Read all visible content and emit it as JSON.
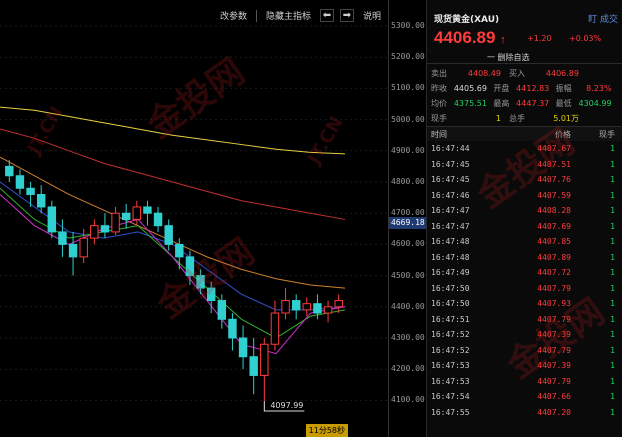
{
  "toolbar": {
    "buttons": [
      "改参数",
      "隐藏主指标",
      "说明"
    ],
    "prev_arrow": "⬅",
    "next_arrow": "➡"
  },
  "y_axis": {
    "ticks": [
      "5300.00",
      "5200.00",
      "5100.00",
      "5000.00",
      "4900.00",
      "4800.00",
      "4700.00",
      "4600.00",
      "4500.00",
      "4400.00",
      "4300.00",
      "4200.00",
      "4100.00"
    ],
    "current_price": "4669.18"
  },
  "chart": {
    "low_label": "4097.99",
    "countdown": "11分58秒"
  },
  "chart_data": {
    "type": "line",
    "ylim": [
      4090,
      5300
    ],
    "candles": [
      [
        4850,
        4820,
        4870,
        4800
      ],
      [
        4820,
        4780,
        4840,
        4760
      ],
      [
        4780,
        4760,
        4800,
        4720
      ],
      [
        4760,
        4720,
        4790,
        4700
      ],
      [
        4720,
        4640,
        4740,
        4620
      ],
      [
        4640,
        4600,
        4680,
        4560
      ],
      [
        4600,
        4560,
        4640,
        4500
      ],
      [
        4560,
        4620,
        4650,
        4540
      ],
      [
        4620,
        4660,
        4680,
        4600
      ],
      [
        4660,
        4640,
        4700,
        4620
      ],
      [
        4640,
        4700,
        4720,
        4630
      ],
      [
        4700,
        4680,
        4730,
        4650
      ],
      [
        4680,
        4720,
        4740,
        4660
      ],
      [
        4720,
        4700,
        4740,
        4660
      ],
      [
        4700,
        4660,
        4720,
        4640
      ],
      [
        4660,
        4600,
        4680,
        4580
      ],
      [
        4600,
        4560,
        4620,
        4520
      ],
      [
        4560,
        4500,
        4580,
        4470
      ],
      [
        4500,
        4460,
        4520,
        4440
      ],
      [
        4460,
        4420,
        4480,
        4380
      ],
      [
        4420,
        4360,
        4440,
        4330
      ],
      [
        4360,
        4300,
        4380,
        4260
      ],
      [
        4300,
        4240,
        4340,
        4200
      ],
      [
        4240,
        4180,
        4300,
        4120
      ],
      [
        4180,
        4280,
        4300,
        4098
      ],
      [
        4280,
        4380,
        4420,
        4260
      ],
      [
        4380,
        4420,
        4460,
        4360
      ],
      [
        4420,
        4390,
        4440,
        4360
      ],
      [
        4390,
        4410,
        4430,
        4370
      ],
      [
        4410,
        4380,
        4440,
        4360
      ],
      [
        4380,
        4400,
        4420,
        4350
      ],
      [
        4400,
        4420,
        4440,
        4380
      ]
    ],
    "series": [
      {
        "values": [
          5040,
          5030,
          5010,
          4990,
          4970,
          4950,
          4935,
          4920,
          4905,
          4895,
          4890
        ]
      },
      {
        "values": [
          4970,
          4940,
          4900,
          4860,
          4830,
          4800,
          4770,
          4740,
          4720,
          4700,
          4680
        ]
      },
      {
        "values": [
          4880,
          4820,
          4760,
          4710,
          4660,
          4610,
          4560,
          4520,
          4490,
          4470,
          4460
        ]
      },
      {
        "values": [
          4800,
          4720,
          4640,
          4620,
          4640,
          4600,
          4520,
          4440,
          4390,
          4390,
          4400
        ]
      },
      {
        "values": [
          4780,
          4680,
          4620,
          4640,
          4660,
          4560,
          4460,
          4360,
          4300,
          4370,
          4390
        ]
      },
      {
        "values": [
          4760,
          4660,
          4600,
          4650,
          4680,
          4560,
          4420,
          4280,
          4250,
          4380,
          4400
        ]
      }
    ],
    "series_colors": [
      "#e8d040",
      "#c03030",
      "#d08030",
      "#3050d0",
      "#30b030",
      "#d030d0"
    ]
  },
  "panel": {
    "title": "现货黄金(XAU)",
    "volume_label": "盯 成交",
    "price": "4406.89",
    "arrow": "↑",
    "change": "+1.20",
    "change_pct": "+0.03%",
    "fav_label": "一 删除自选",
    "quote_rows": [
      [
        {
          "l": "卖出",
          "v": "4408.49",
          "c": "red"
        },
        {
          "l": "买入",
          "v": "4406.89",
          "c": "red"
        }
      ],
      [
        {
          "l": "昨收",
          "v": "4405.69",
          "c": "white"
        },
        {
          "l": "开盘",
          "v": "4412.83",
          "c": "red"
        },
        {
          "l": "振幅",
          "v": "8.23%",
          "c": "red"
        }
      ],
      [
        {
          "l": "均价",
          "v": "4375.51",
          "c": "green"
        },
        {
          "l": "最高",
          "v": "4447.37",
          "c": "red"
        },
        {
          "l": "最低",
          "v": "4304.99",
          "c": "green"
        }
      ],
      [
        {
          "l": "现手",
          "v": "1",
          "c": "yellow"
        },
        {
          "l": "总手",
          "v": "5.01万",
          "c": "yellow"
        }
      ]
    ],
    "trade_headers": [
      "时间",
      "价格",
      "现手"
    ],
    "trades": [
      {
        "t": "16:47:44",
        "p": "4407.67",
        "v": "1"
      },
      {
        "t": "16:47:45",
        "p": "4407.51",
        "v": "1"
      },
      {
        "t": "16:47:45",
        "p": "4407.76",
        "v": "1"
      },
      {
        "t": "16:47:46",
        "p": "4407.59",
        "v": "1"
      },
      {
        "t": "16:47:47",
        "p": "4408.28",
        "v": "1"
      },
      {
        "t": "16:47:47",
        "p": "4407.69",
        "v": "1"
      },
      {
        "t": "16:47:48",
        "p": "4407.85",
        "v": "1"
      },
      {
        "t": "16:47:48",
        "p": "4407.89",
        "v": "1"
      },
      {
        "t": "16:47:49",
        "p": "4407.72",
        "v": "1"
      },
      {
        "t": "16:47:50",
        "p": "4407.79",
        "v": "1"
      },
      {
        "t": "16:47:50",
        "p": "4407.93",
        "v": "1"
      },
      {
        "t": "16:47:51",
        "p": "4407.79",
        "v": "1"
      },
      {
        "t": "16:47:52",
        "p": "4407.39",
        "v": "1"
      },
      {
        "t": "16:47:52",
        "p": "4407.79",
        "v": "1"
      },
      {
        "t": "16:47:53",
        "p": "4407.39",
        "v": "1"
      },
      {
        "t": "16:47:53",
        "p": "4407.79",
        "v": "1"
      },
      {
        "t": "16:47:54",
        "p": "4407.66",
        "v": "1"
      },
      {
        "t": "16:47:55",
        "p": "4407.20",
        "v": "1"
      }
    ]
  },
  "watermark": [
    "金投网",
    "JT.CN"
  ]
}
